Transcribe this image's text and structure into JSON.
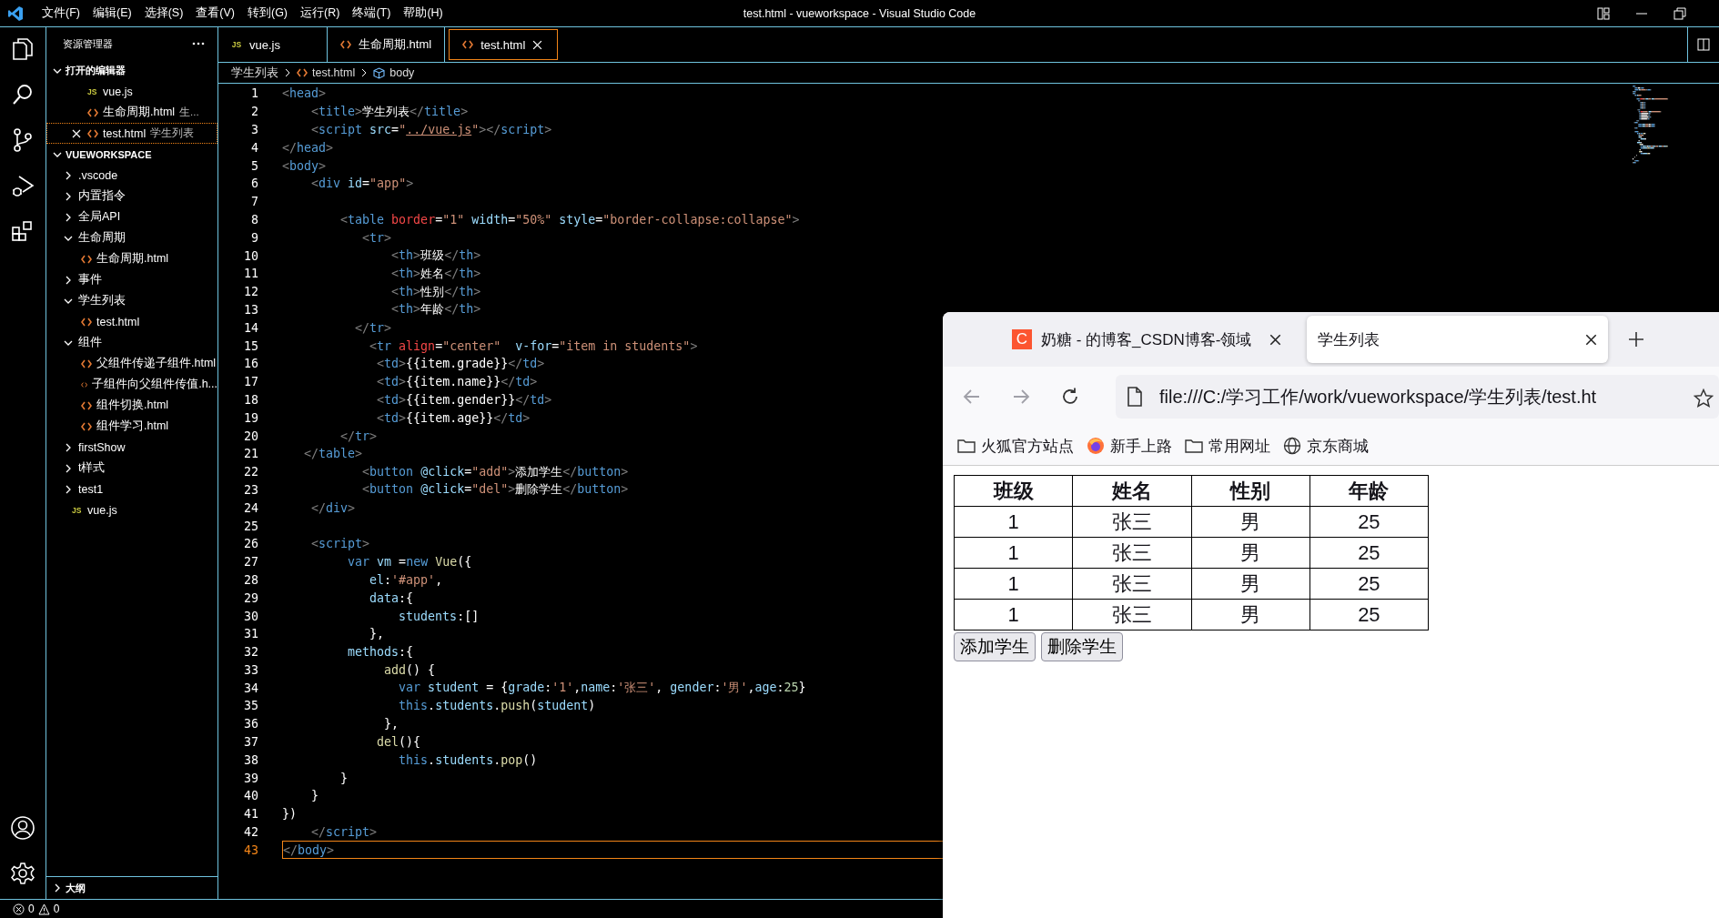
{
  "title_bar": {
    "menu": [
      "文件(F)",
      "编辑(E)",
      "选择(S)",
      "查看(V)",
      "转到(G)",
      "运行(R)",
      "终端(T)",
      "帮助(H)"
    ],
    "title": "test.html - vueworkspace - Visual Studio Code"
  },
  "sidebar": {
    "title": "资源管理器",
    "open_editors": {
      "label": "打开的编辑器",
      "expanded": true,
      "items": [
        {
          "name": "vue.js",
          "kind": "js",
          "icon_label": "JS",
          "selected": false
        },
        {
          "name": "生命周期.html",
          "kind": "html",
          "description": "生...",
          "selected": false
        },
        {
          "name": "test.html",
          "kind": "html",
          "description": "学生列表",
          "selected": true
        }
      ]
    },
    "workspace": {
      "label": "VUEWORKSPACE",
      "expanded": true,
      "items": [
        {
          "name": ".vscode",
          "kind": "folder",
          "expanded": false
        },
        {
          "name": "内置指令",
          "kind": "folder",
          "expanded": false
        },
        {
          "name": "全局API",
          "kind": "folder",
          "expanded": false
        },
        {
          "name": "生命周期",
          "kind": "folder",
          "expanded": true,
          "children": [
            {
              "name": "生命周期.html",
              "kind": "html"
            }
          ]
        },
        {
          "name": "事件",
          "kind": "folder",
          "expanded": false
        },
        {
          "name": "学生列表",
          "kind": "folder",
          "expanded": true,
          "children": [
            {
              "name": "test.html",
              "kind": "html"
            }
          ]
        },
        {
          "name": "组件",
          "kind": "folder",
          "expanded": true,
          "children": [
            {
              "name": "父组件传递子组件.html",
              "kind": "html"
            },
            {
              "name": "子组件向父组件传值.h...",
              "kind": "html"
            },
            {
              "name": "组件切换.html",
              "kind": "html"
            },
            {
              "name": "组件学习.html",
              "kind": "html"
            }
          ]
        },
        {
          "name": "firstShow",
          "kind": "folder",
          "expanded": false
        },
        {
          "name": "t样式",
          "kind": "folder",
          "expanded": false
        },
        {
          "name": "test1",
          "kind": "folder",
          "expanded": false
        },
        {
          "name": "vue.js",
          "kind": "js",
          "icon_label": "JS"
        }
      ]
    },
    "outline": {
      "label": "大纲",
      "expanded": false
    }
  },
  "editor": {
    "tabs": [
      {
        "name": "vue.js",
        "kind": "js",
        "icon_label": "JS",
        "selected": false
      },
      {
        "name": "生命周期.html",
        "kind": "html",
        "selected": false
      },
      {
        "name": "test.html",
        "kind": "html",
        "selected": true
      }
    ],
    "breadcrumb": [
      {
        "label": "学生列表",
        "kind": "folder"
      },
      {
        "label": "test.html",
        "kind": "html"
      },
      {
        "label": "body",
        "kind": "symbol"
      }
    ],
    "lines": [
      {
        "number": "1",
        "current": false,
        "tokens": [
          {
            "kind": "bracket",
            "text": "<"
          },
          {
            "kind": "tag",
            "text": "head"
          },
          {
            "kind": "bracket",
            "text": ">"
          }
        ]
      },
      {
        "number": "2",
        "current": false,
        "tokens": [
          {
            "kind": "bracket",
            "text": "    <"
          },
          {
            "kind": "tag",
            "text": "title"
          },
          {
            "kind": "bracket",
            "text": ">"
          },
          {
            "kind": "plain",
            "text": "学生列表"
          },
          {
            "kind": "bracket",
            "text": "</"
          },
          {
            "kind": "tag",
            "text": "title"
          },
          {
            "kind": "bracket",
            "text": ">"
          }
        ]
      },
      {
        "number": "3",
        "current": false,
        "tokens": [
          {
            "kind": "bracket",
            "text": "    <"
          },
          {
            "kind": "tag",
            "text": "script"
          },
          {
            "kind": "attr",
            "text": " src"
          },
          {
            "kind": "plain",
            "text": "="
          },
          {
            "kind": "string",
            "text": "\""
          },
          {
            "kind": "link",
            "text": "../vue.js"
          },
          {
            "kind": "string",
            "text": "\""
          },
          {
            "kind": "bracket",
            "text": "></"
          },
          {
            "kind": "tag",
            "text": "script"
          },
          {
            "kind": "bracket",
            "text": ">"
          }
        ]
      },
      {
        "number": "4",
        "current": false,
        "tokens": [
          {
            "kind": "bracket",
            "text": "</"
          },
          {
            "kind": "tag",
            "text": "head"
          },
          {
            "kind": "bracket",
            "text": ">"
          }
        ]
      },
      {
        "number": "5",
        "current": false,
        "tokens": [
          {
            "kind": "bracket",
            "text": "<"
          },
          {
            "kind": "tag",
            "text": "body"
          },
          {
            "kind": "bracket",
            "text": ">"
          }
        ]
      },
      {
        "number": "6",
        "current": false,
        "tokens": [
          {
            "kind": "bracket",
            "text": "    <"
          },
          {
            "kind": "tag",
            "text": "div"
          },
          {
            "kind": "attr",
            "text": " id"
          },
          {
            "kind": "plain",
            "text": "="
          },
          {
            "kind": "string",
            "text": "\"app\""
          },
          {
            "kind": "bracket",
            "text": ">"
          }
        ]
      },
      {
        "number": "7",
        "current": false
      },
      {
        "number": "8",
        "current": false,
        "tokens": [
          {
            "kind": "bracket",
            "text": "        <"
          },
          {
            "kind": "tag",
            "text": "table"
          },
          {
            "kind": "attr-special",
            "text": " border"
          },
          {
            "kind": "plain",
            "text": "="
          },
          {
            "kind": "string",
            "text": "\"1\""
          },
          {
            "kind": "attr",
            "text": " width"
          },
          {
            "kind": "plain",
            "text": "="
          },
          {
            "kind": "string",
            "text": "\"50%\""
          },
          {
            "kind": "attr",
            "text": " style"
          },
          {
            "kind": "plain",
            "text": "="
          },
          {
            "kind": "string",
            "text": "\"border-collapse:collapse\""
          },
          {
            "kind": "bracket",
            "text": ">"
          }
        ]
      },
      {
        "number": "9",
        "current": false,
        "tokens": [
          {
            "kind": "bracket",
            "text": "           <"
          },
          {
            "kind": "tag",
            "text": "tr"
          },
          {
            "kind": "bracket",
            "text": ">"
          }
        ]
      },
      {
        "number": "10",
        "current": false,
        "tokens": [
          {
            "kind": "bracket",
            "text": "               <"
          },
          {
            "kind": "tag",
            "text": "th"
          },
          {
            "kind": "bracket",
            "text": ">"
          },
          {
            "kind": "plain",
            "text": "班级"
          },
          {
            "kind": "bracket",
            "text": "</"
          },
          {
            "kind": "tag",
            "text": "th"
          },
          {
            "kind": "bracket",
            "text": ">"
          }
        ]
      },
      {
        "number": "11",
        "current": false,
        "tokens": [
          {
            "kind": "bracket",
            "text": "               <"
          },
          {
            "kind": "tag",
            "text": "th"
          },
          {
            "kind": "bracket",
            "text": ">"
          },
          {
            "kind": "plain",
            "text": "姓名"
          },
          {
            "kind": "bracket",
            "text": "</"
          },
          {
            "kind": "tag",
            "text": "th"
          },
          {
            "kind": "bracket",
            "text": ">"
          }
        ]
      },
      {
        "number": "12",
        "current": false,
        "tokens": [
          {
            "kind": "bracket",
            "text": "               <"
          },
          {
            "kind": "tag",
            "text": "th"
          },
          {
            "kind": "bracket",
            "text": ">"
          },
          {
            "kind": "plain",
            "text": "性别"
          },
          {
            "kind": "bracket",
            "text": "</"
          },
          {
            "kind": "tag",
            "text": "th"
          },
          {
            "kind": "bracket",
            "text": ">"
          }
        ]
      },
      {
        "number": "13",
        "current": false,
        "tokens": [
          {
            "kind": "bracket",
            "text": "               <"
          },
          {
            "kind": "tag",
            "text": "th"
          },
          {
            "kind": "bracket",
            "text": ">"
          },
          {
            "kind": "plain",
            "text": "年龄"
          },
          {
            "kind": "bracket",
            "text": "</"
          },
          {
            "kind": "tag",
            "text": "th"
          },
          {
            "kind": "bracket",
            "text": ">"
          }
        ]
      },
      {
        "number": "14",
        "current": false,
        "tokens": [
          {
            "kind": "bracket",
            "text": "          </"
          },
          {
            "kind": "tag",
            "text": "tr"
          },
          {
            "kind": "bracket",
            "text": ">"
          }
        ]
      },
      {
        "number": "15",
        "current": false,
        "tokens": [
          {
            "kind": "bracket",
            "text": "            <"
          },
          {
            "kind": "tag",
            "text": "tr"
          },
          {
            "kind": "attr-special",
            "text": " align"
          },
          {
            "kind": "plain",
            "text": "="
          },
          {
            "kind": "string",
            "text": "\"center\""
          },
          {
            "kind": "attr",
            "text": "  v-for"
          },
          {
            "kind": "plain",
            "text": "="
          },
          {
            "kind": "string",
            "text": "\"item in students\""
          },
          {
            "kind": "bracket",
            "text": ">"
          }
        ]
      },
      {
        "number": "16",
        "current": false,
        "tokens": [
          {
            "kind": "bracket",
            "text": "             <"
          },
          {
            "kind": "tag",
            "text": "td"
          },
          {
            "kind": "bracket",
            "text": ">"
          },
          {
            "kind": "plain",
            "text": "{{item.grade}}"
          },
          {
            "kind": "bracket",
            "text": "</"
          },
          {
            "kind": "tag",
            "text": "td"
          },
          {
            "kind": "bracket",
            "text": ">"
          }
        ]
      },
      {
        "number": "17",
        "current": false,
        "tokens": [
          {
            "kind": "bracket",
            "text": "             <"
          },
          {
            "kind": "tag",
            "text": "td"
          },
          {
            "kind": "bracket",
            "text": ">"
          },
          {
            "kind": "plain",
            "text": "{{item.name}}"
          },
          {
            "kind": "bracket",
            "text": "</"
          },
          {
            "kind": "tag",
            "text": "td"
          },
          {
            "kind": "bracket",
            "text": ">"
          }
        ]
      },
      {
        "number": "18",
        "current": false,
        "tokens": [
          {
            "kind": "bracket",
            "text": "             <"
          },
          {
            "kind": "tag",
            "text": "td"
          },
          {
            "kind": "bracket",
            "text": ">"
          },
          {
            "kind": "plain",
            "text": "{{item.gender}}"
          },
          {
            "kind": "bracket",
            "text": "</"
          },
          {
            "kind": "tag",
            "text": "td"
          },
          {
            "kind": "bracket",
            "text": ">"
          }
        ]
      },
      {
        "number": "19",
        "current": false,
        "tokens": [
          {
            "kind": "bracket",
            "text": "             <"
          },
          {
            "kind": "tag",
            "text": "td"
          },
          {
            "kind": "bracket",
            "text": ">"
          },
          {
            "kind": "plain",
            "text": "{{item.age}}"
          },
          {
            "kind": "bracket",
            "text": "</"
          },
          {
            "kind": "tag",
            "text": "td"
          },
          {
            "kind": "bracket",
            "text": ">"
          }
        ]
      },
      {
        "number": "20",
        "current": false,
        "tokens": [
          {
            "kind": "bracket",
            "text": "        </"
          },
          {
            "kind": "tag",
            "text": "tr"
          },
          {
            "kind": "bracket",
            "text": ">"
          }
        ]
      },
      {
        "number": "21",
        "current": false,
        "tokens": [
          {
            "kind": "bracket",
            "text": "   </"
          },
          {
            "kind": "tag",
            "text": "table"
          },
          {
            "kind": "bracket",
            "text": ">"
          }
        ]
      },
      {
        "number": "22",
        "current": false,
        "tokens": [
          {
            "kind": "bracket",
            "text": "           <"
          },
          {
            "kind": "tag",
            "text": "button"
          },
          {
            "kind": "attr",
            "text": " @click"
          },
          {
            "kind": "plain",
            "text": "="
          },
          {
            "kind": "string",
            "text": "\"add\""
          },
          {
            "kind": "bracket",
            "text": ">"
          },
          {
            "kind": "plain",
            "text": "添加学生"
          },
          {
            "kind": "bracket",
            "text": "</"
          },
          {
            "kind": "tag",
            "text": "button"
          },
          {
            "kind": "bracket",
            "text": ">"
          }
        ]
      },
      {
        "number": "23",
        "current": false,
        "tokens": [
          {
            "kind": "bracket",
            "text": "           <"
          },
          {
            "kind": "tag",
            "text": "button"
          },
          {
            "kind": "attr",
            "text": " @click"
          },
          {
            "kind": "plain",
            "text": "="
          },
          {
            "kind": "string",
            "text": "\"del\""
          },
          {
            "kind": "bracket",
            "text": ">"
          },
          {
            "kind": "plain",
            "text": "删除学生"
          },
          {
            "kind": "bracket",
            "text": "</"
          },
          {
            "kind": "tag",
            "text": "button"
          },
          {
            "kind": "bracket",
            "text": ">"
          }
        ]
      },
      {
        "number": "24",
        "current": false,
        "tokens": [
          {
            "kind": "bracket",
            "text": "    </"
          },
          {
            "kind": "tag",
            "text": "div"
          },
          {
            "kind": "bracket",
            "text": ">"
          }
        ]
      },
      {
        "number": "25",
        "current": false
      },
      {
        "number": "26",
        "current": false,
        "tokens": [
          {
            "kind": "bracket",
            "text": "    <"
          },
          {
            "kind": "tag",
            "text": "script"
          },
          {
            "kind": "bracket",
            "text": ">"
          }
        ]
      },
      {
        "number": "27",
        "current": false,
        "tokens": [
          {
            "kind": "keyword",
            "text": "         var"
          },
          {
            "kind": "var",
            "text": " vm"
          },
          {
            "kind": "plain",
            "text": " ="
          },
          {
            "kind": "keyword",
            "text": "new"
          },
          {
            "kind": "func",
            "text": " Vue"
          },
          {
            "kind": "plain",
            "text": "({"
          }
        ]
      },
      {
        "number": "28",
        "current": false,
        "tokens": [
          {
            "kind": "var",
            "text": "            el"
          },
          {
            "kind": "plain",
            "text": ":"
          },
          {
            "kind": "string",
            "text": "'#app'"
          },
          {
            "kind": "plain",
            "text": ","
          }
        ]
      },
      {
        "number": "29",
        "current": false,
        "tokens": [
          {
            "kind": "var",
            "text": "            data"
          },
          {
            "kind": "plain",
            "text": ":{"
          }
        ]
      },
      {
        "number": "30",
        "current": false,
        "tokens": [
          {
            "kind": "var",
            "text": "                students"
          },
          {
            "kind": "plain",
            "text": ":[]"
          }
        ]
      },
      {
        "number": "31",
        "current": false,
        "tokens": [
          {
            "kind": "plain",
            "text": "            },"
          }
        ]
      },
      {
        "number": "32",
        "current": false,
        "tokens": [
          {
            "kind": "var",
            "text": "         methods"
          },
          {
            "kind": "plain",
            "text": ":{"
          }
        ]
      },
      {
        "number": "33",
        "current": false,
        "tokens": [
          {
            "kind": "func",
            "text": "              add"
          },
          {
            "kind": "plain",
            "text": "() {"
          }
        ]
      },
      {
        "number": "34",
        "current": false,
        "tokens": [
          {
            "kind": "keyword",
            "text": "                var"
          },
          {
            "kind": "var",
            "text": " student"
          },
          {
            "kind": "plain",
            "text": " = {"
          },
          {
            "kind": "var",
            "text": "grade"
          },
          {
            "kind": "plain",
            "text": ":"
          },
          {
            "kind": "string",
            "text": "'1'"
          },
          {
            "kind": "plain",
            "text": ","
          },
          {
            "kind": "var",
            "text": "name"
          },
          {
            "kind": "plain",
            "text": ":"
          },
          {
            "kind": "string",
            "text": "'张三'"
          },
          {
            "kind": "plain",
            "text": ", "
          },
          {
            "kind": "var",
            "text": "gender"
          },
          {
            "kind": "plain",
            "text": ":"
          },
          {
            "kind": "string",
            "text": "'男'"
          },
          {
            "kind": "plain",
            "text": ","
          },
          {
            "kind": "var",
            "text": "age"
          },
          {
            "kind": "plain",
            "text": ":"
          },
          {
            "kind": "number",
            "text": "25"
          },
          {
            "kind": "plain",
            "text": "}"
          }
        ]
      },
      {
        "number": "35",
        "current": false,
        "tokens": [
          {
            "kind": "keyword",
            "text": "                this"
          },
          {
            "kind": "plain",
            "text": "."
          },
          {
            "kind": "var",
            "text": "students"
          },
          {
            "kind": "plain",
            "text": "."
          },
          {
            "kind": "func",
            "text": "push"
          },
          {
            "kind": "plain",
            "text": "("
          },
          {
            "kind": "var",
            "text": "student"
          },
          {
            "kind": "plain",
            "text": ")"
          }
        ]
      },
      {
        "number": "36",
        "current": false,
        "tokens": [
          {
            "kind": "plain",
            "text": "              },"
          }
        ]
      },
      {
        "number": "37",
        "current": false,
        "tokens": [
          {
            "kind": "func",
            "text": "             del"
          },
          {
            "kind": "plain",
            "text": "(){"
          }
        ]
      },
      {
        "number": "38",
        "current": false,
        "tokens": [
          {
            "kind": "keyword",
            "text": "                this"
          },
          {
            "kind": "plain",
            "text": "."
          },
          {
            "kind": "var",
            "text": "students"
          },
          {
            "kind": "plain",
            "text": "."
          },
          {
            "kind": "func",
            "text": "pop"
          },
          {
            "kind": "plain",
            "text": "()"
          }
        ]
      },
      {
        "number": "39",
        "current": false,
        "tokens": [
          {
            "kind": "plain",
            "text": "        }"
          }
        ]
      },
      {
        "number": "40",
        "current": false,
        "tokens": [
          {
            "kind": "plain",
            "text": "    }"
          }
        ]
      },
      {
        "number": "41",
        "current": false,
        "tokens": [
          {
            "kind": "plain",
            "text": "})"
          }
        ]
      },
      {
        "number": "42",
        "current": false,
        "tokens": [
          {
            "kind": "bracket",
            "text": "    </"
          },
          {
            "kind": "tag",
            "text": "script"
          },
          {
            "kind": "bracket",
            "text": ">"
          }
        ]
      },
      {
        "number": "43",
        "current": true,
        "tokens": [
          {
            "kind": "bracket",
            "text": "</"
          },
          {
            "kind": "tag",
            "text": "body"
          },
          {
            "kind": "bracket",
            "text": ">"
          }
        ]
      }
    ]
  },
  "browser": {
    "tabs": [
      {
        "title": "奶糖 - 的博客_CSDN博客-领域",
        "icon_letter": "C",
        "selected": false
      },
      {
        "title": "学生列表",
        "selected": true
      }
    ],
    "can_go_back": false,
    "can_go_forward": false,
    "url": "file:///C:/学习工作/work/vueworkspace/学生列表/test.ht",
    "bookmarks": [
      {
        "label": "火狐官方站点",
        "kind": "folder"
      },
      {
        "label": "新手上路",
        "kind": "firefox"
      },
      {
        "label": "常用网址",
        "kind": "folder"
      },
      {
        "label": "京东商城",
        "kind": "globe"
      }
    ],
    "table": {
      "columns": [
        "班级",
        "姓名",
        "性别",
        "年龄"
      ],
      "rows": [
        [
          "1",
          "张三",
          "男",
          "25"
        ],
        [
          "1",
          "张三",
          "男",
          "25"
        ],
        [
          "1",
          "张三",
          "男",
          "25"
        ],
        [
          "1",
          "张三",
          "男",
          "25"
        ]
      ]
    },
    "buttons": [
      "添加学生",
      "删除学生"
    ]
  },
  "status_bar": {
    "errors": "0",
    "warnings": "0"
  }
}
